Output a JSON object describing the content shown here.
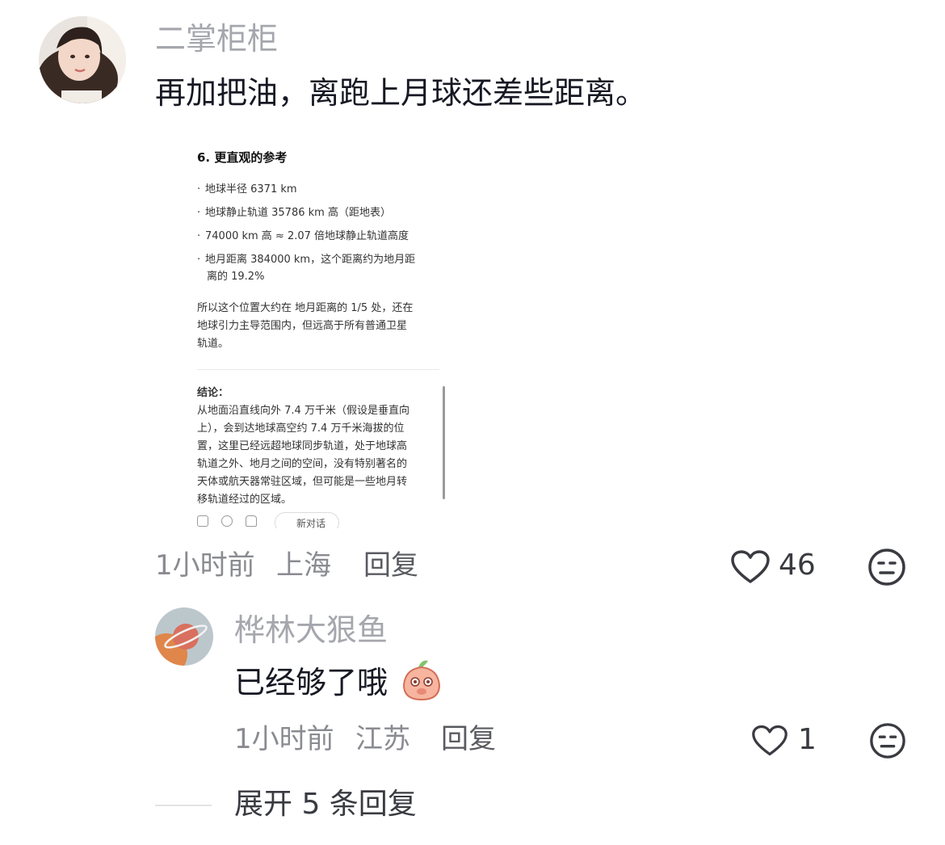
{
  "comment1": {
    "username": "二掌柜柜",
    "text": "再加把油，离跑上月球还差些距离。",
    "time": "1小时前",
    "location": "上海",
    "reply_label": "回复",
    "like_count": "46",
    "avatar_icon": "user-avatar-photo",
    "screenshot": {
      "title": "6. 更直观的参考",
      "bullets": [
        "地球半径 6371 km",
        "地球静止轨道 35786 km 高（距地表）",
        "74000 km 高 ≈ 2.07 倍地球静止轨道高度",
        "地月距离 384000 km，这个距离约为地月距",
        "离的 19.2%"
      ],
      "para1_line1": "所以这个位置大约在 地月距离的 1/5 处，还在",
      "para1_line2": "地球引力主导范围内，但远高于所有普通卫星",
      "para1_line3": "轨道。",
      "conclusion_label": "结论：",
      "conclusion_lines": [
        "从地面沿直线向外 7.4 万千米（假设是垂直向",
        "上），会到达地球高空约 7.4 万千米海拔的位",
        "置，这里已经远超地球同步轨道，处于地球高",
        "轨道之外、地月之间的空间，没有特别著名的",
        "天体或航天器常驻区域，但可能是一些地月转",
        "移轨道经过的区域。"
      ],
      "new_chat_label": "新对话"
    }
  },
  "comment2": {
    "username": "桦林大狠鱼",
    "text": "已经够了哦",
    "time": "1小时前",
    "location": "江苏",
    "reply_label": "回复",
    "like_count": "1",
    "emoji_icon": "peach-shy-emoji",
    "avatar_icon": "planet-avatar"
  },
  "expand_replies": "展开 5 条回复",
  "colors": {
    "primary_text": "#161823",
    "secondary_text": "#8a8b91",
    "username": "#a5a7ad"
  }
}
